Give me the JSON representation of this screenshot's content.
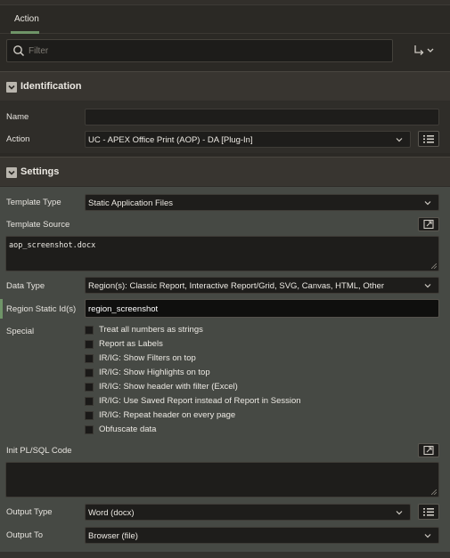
{
  "tabs": [
    {
      "label": "Action"
    }
  ],
  "search": {
    "placeholder": "Filter"
  },
  "sections": {
    "identification": {
      "title": "Identification",
      "name_label": "Name",
      "name_value": "",
      "action_label": "Action",
      "action_value": "UC - APEX Office Print (AOP) - DA [Plug-In]"
    },
    "settings": {
      "title": "Settings",
      "template_type_label": "Template Type",
      "template_type_value": "Static Application Files",
      "template_source_label": "Template Source",
      "template_source_value": "aop_screenshot.docx",
      "data_type_label": "Data Type",
      "data_type_value": "Region(s): Classic Report, Interactive Report/Grid, SVG, Canvas, HTML, Other",
      "region_static_label": "Region Static Id(s)",
      "region_static_value": "region_screenshot",
      "special_label": "Special",
      "special_options": [
        {
          "label": "Treat all numbers as strings",
          "checked": false
        },
        {
          "label": "Report as Labels",
          "checked": false
        },
        {
          "label": "IR/IG: Show Filters on top",
          "checked": false
        },
        {
          "label": "IR/IG: Show Highlights on top",
          "checked": false
        },
        {
          "label": "IR/IG: Show header with filter (Excel)",
          "checked": false
        },
        {
          "label": "IR/IG: Use Saved Report instead of Report in Session",
          "checked": false
        },
        {
          "label": "IR/IG: Repeat header on every page",
          "checked": false
        },
        {
          "label": "Obfuscate data",
          "checked": false
        }
      ],
      "init_plsql_label": "Init PL/SQL Code",
      "init_plsql_value": "",
      "output_type_label": "Output Type",
      "output_type_value": "Word (docx)",
      "output_to_label": "Output To",
      "output_to_value": "Browser (file)"
    }
  },
  "colors": {
    "accent": "#6f9468",
    "panel": "#464944",
    "header": "#383530"
  }
}
